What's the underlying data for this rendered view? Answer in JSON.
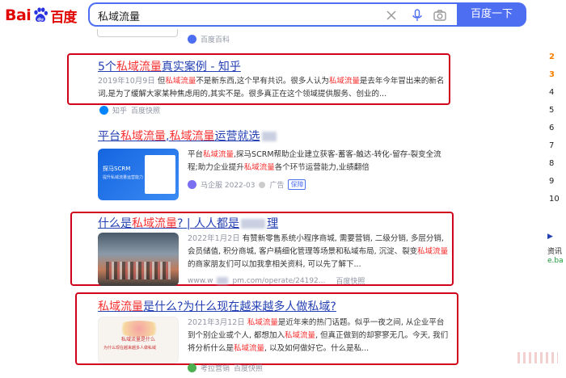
{
  "search": {
    "query": "私域流量",
    "button_label": "百度一下"
  },
  "logo": {
    "latin": "Bai",
    "chinese": "百度"
  },
  "top_partial": {
    "source": "百度百科"
  },
  "results": [
    {
      "title": "5个私域流量真实案例 - 知乎",
      "date": "2019年10月9日",
      "snippet": "但私域流量不是新东西,这个早有共识。很多人认为私域流量是去年今年冒出来的新名词,是为了缓解大家某种焦虑用的,其实不是。很多真正在这个领域提供服务、创业的...",
      "source": "知乎",
      "source_extra": "百度快照"
    },
    {
      "title": "平台私域流量,私域流量运营就选",
      "snippet": "平台私域流量,探马SCRM帮助企业建立获客-蓄客-触达-转化-留存-裂变全流程;助力企业提升私域流量各个环节运营能力,业绩翻倍",
      "source": "马企服 2022-03",
      "ad_label": "广告",
      "badge": "保障",
      "thumb_text": "探马SCRM",
      "thumb_sub": "提升私域流量运营能力"
    },
    {
      "title": "什么是私域流量? | 人人都是",
      "title_tail": "理",
      "date": "2022年1月2日",
      "snippet": "有赞新零售系统小程序商城, 需要营销, 二级分销, 多层分销, 会员储值, 积分商城, 客户精细化管理等场景和私域布局, 沉淀、裂变私域流量的商家朋友们可以加我拿相关资料, 可以先了解下...",
      "url": "www.w",
      "url_tail": "pm.com/operate/24192...",
      "source_extra": "百度快照"
    },
    {
      "title": "私域流量是什么?为什么现在越来越多人做私域?",
      "date": "2021年3月12日",
      "snippet": "私域流量是近年来的热门话题。似乎一夜之间, 从企业平台到个别企业或个人, 都想加入私域流量, 但真正做到的却寥寥无几。今天, 我们将分析什么是私域流量, 以及如何做好它。什么是私...",
      "source": "考拉营销",
      "source_extra": "百度快照",
      "thumb_text": "私域流量是什么",
      "thumb_sub": "为什么现在越来越多人做私域"
    }
  ],
  "right_column": {
    "numbers": [
      "2",
      "3",
      "4",
      "5",
      "6",
      "7",
      "8",
      "9",
      "10"
    ],
    "tail_1": "▶",
    "tail_2": "资讯",
    "tail_3": "e.ba"
  },
  "colors": {
    "accent": "#4e6ef2",
    "link": "#2440b3",
    "keyword": "#f73131",
    "highlight_box": "#d0021b"
  }
}
